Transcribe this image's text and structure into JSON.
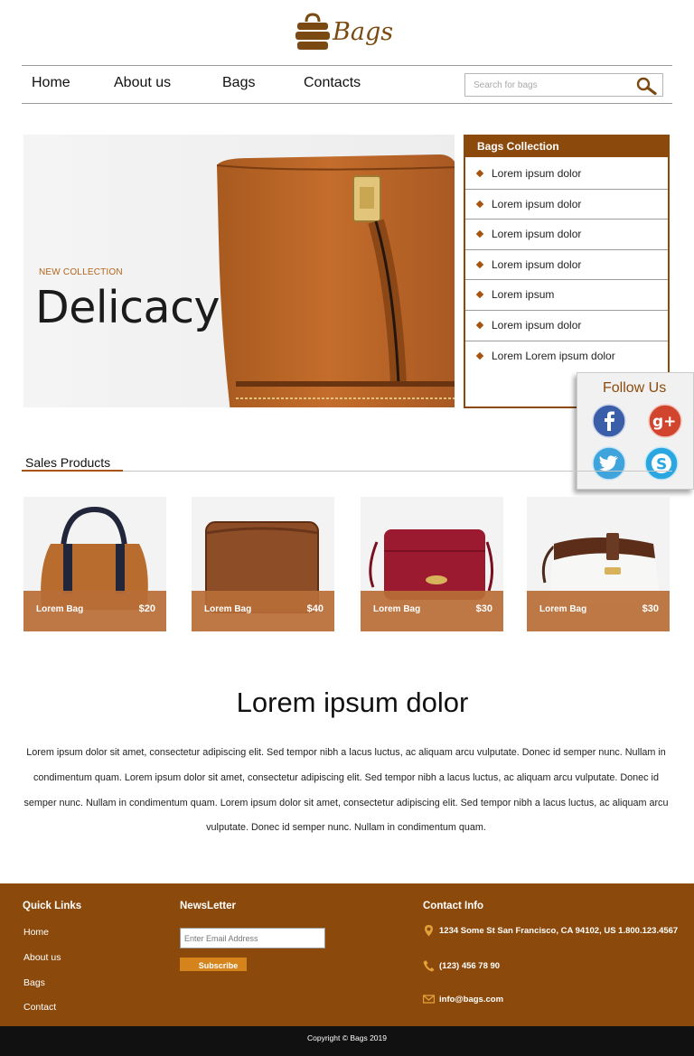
{
  "header": {
    "logo_text": "Bags"
  },
  "nav": {
    "items": [
      {
        "label": "Home"
      },
      {
        "label": "About us"
      },
      {
        "label": "Bags"
      },
      {
        "label": "Contacts"
      }
    ],
    "search_placeholder": "Search for bags"
  },
  "hero": {
    "kicker": "NEW COLLECTION",
    "title": "Delicacy"
  },
  "collection": {
    "title": "Bags Collection",
    "items": [
      {
        "label": "Lorem ipsum dolor"
      },
      {
        "label": "Lorem ipsum dolor"
      },
      {
        "label": "Lorem ipsum dolor"
      },
      {
        "label": "Lorem ipsum dolor"
      },
      {
        "label": "Lorem ipsum"
      },
      {
        "label": "Lorem ipsum dolor"
      },
      {
        "label": "Lorem Lorem ipsum dolor"
      }
    ]
  },
  "follow": {
    "title": "Follow Us",
    "networks": [
      "facebook-icon",
      "google-plus-icon",
      "twitter-icon",
      "skype-icon"
    ]
  },
  "sales": {
    "title": "Sales Products",
    "products": [
      {
        "name": "Lorem Bag",
        "price": "$20"
      },
      {
        "name": "Lorem Bag",
        "price": "$40"
      },
      {
        "name": "Lorem Bag",
        "price": "$30"
      },
      {
        "name": "Lorem Bag",
        "price": "$30"
      }
    ]
  },
  "about": {
    "title": "Lorem ipsum dolor",
    "text": "Lorem ipsum dolor sit amet, consectetur adipiscing elit. Sed tempor nibh a lacus luctus, ac aliquam arcu vulputate. Donec id semper nunc. Nullam in condimentum quam.  Lorem ipsum dolor sit amet, consectetur adipiscing elit. Sed tempor nibh a lacus luctus, ac aliquam arcu vulputate. Donec id semper nunc. Nullam in condimentum quam. Lorem ipsum dolor sit amet, consectetur adipiscing elit. Sed tempor nibh a lacus luctus, ac aliquam arcu vulputate. Donec id semper nunc. Nullam in condimentum quam."
  },
  "footer": {
    "quick_links_title": "Quick Links",
    "quick_links": [
      {
        "label": "Home"
      },
      {
        "label": "About us"
      },
      {
        "label": "Bags"
      },
      {
        "label": "Contact"
      }
    ],
    "newsletter_title": "NewsLetter",
    "newsletter_placeholder": "Enter Email Address",
    "subscribe_label": "Subscribe",
    "contact_title": "Contact Info",
    "address": "1234 Some St San Francisco, CA 94102, US 1.800.123.4567",
    "phone": "(123) 456 78 90",
    "email": "info@bags.com",
    "copyright": "Copyright © Bags 2019"
  },
  "colors": {
    "brand_brown": "#8b4a0c",
    "accent_orange": "#d4841a",
    "product_bar": "#b86e37"
  }
}
